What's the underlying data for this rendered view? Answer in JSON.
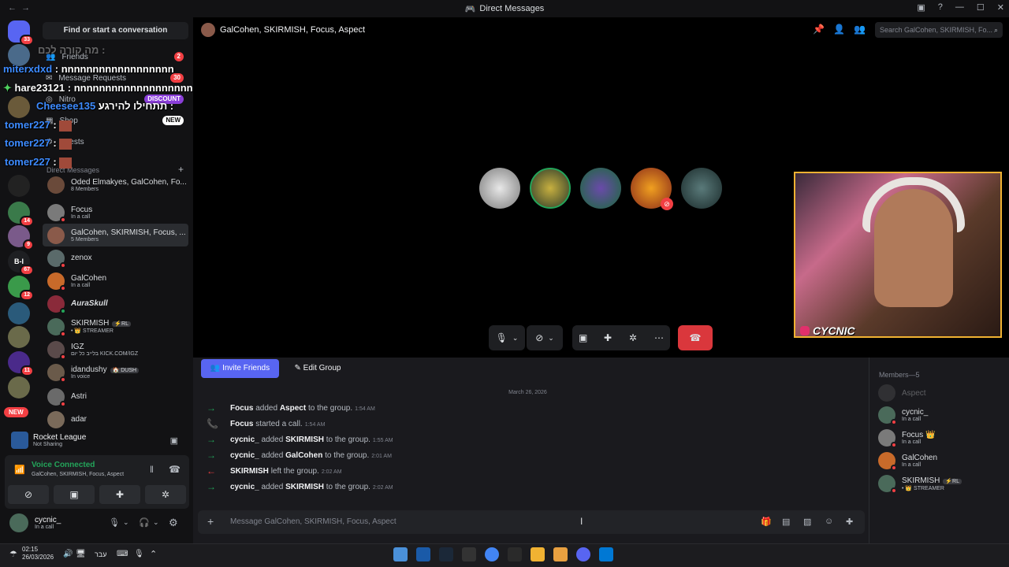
{
  "window": {
    "title": "Direct Messages"
  },
  "sidebar": {
    "find": "Find or start a conversation",
    "nav": [
      {
        "label": "Friends",
        "badge": "2"
      },
      {
        "label": "Message Requests",
        "badge": "30"
      },
      {
        "label": "Nitro",
        "badge": "DISCOUNT"
      },
      {
        "label": "Shop",
        "badge": "NEW"
      },
      {
        "label": "Quests",
        "badge": ""
      }
    ],
    "dm_header": "Direct Messages",
    "dm_add": "+",
    "dms": [
      {
        "name": "Oded Elmakyes, GalCohen, Fo...",
        "sub": "8 Members"
      },
      {
        "name": "Focus",
        "sub": "In a call"
      },
      {
        "name": "GalCohen, SKIRMISH, Focus, ...",
        "sub": "5 Members"
      },
      {
        "name": "zenox",
        "sub": ""
      },
      {
        "name": "GalCohen",
        "sub": "In a call"
      },
      {
        "name": "AuraSkull",
        "sub": ""
      },
      {
        "name": "SKIRMISH",
        "tag": "⚡RL",
        "sub": "• 👑 STREAMER"
      },
      {
        "name": "IGZ",
        "sub": "בלייב כל יום KICK.COM/IGZ"
      },
      {
        "name": "idandushy",
        "tag": "🏠 DUSH",
        "sub": "In voice"
      },
      {
        "name": "Astri",
        "sub": ""
      },
      {
        "name": "adar",
        "sub": ""
      }
    ],
    "game": {
      "title": "Rocket League",
      "sub": "Not Sharing"
    },
    "voice": {
      "status": "Voice Connected",
      "channel": "GalCohen, SKIRMISH, Focus, Aspect"
    },
    "user": {
      "name": "cycnic_",
      "status": "In a call"
    }
  },
  "rail": {
    "badges": [
      "33",
      "14",
      "9",
      "67",
      "12",
      "11"
    ],
    "new_label": "NEW",
    "bi_label": "B-I"
  },
  "overlay": [
    {
      "user": "",
      "text": "מה קורה לכם : ",
      "faint": true
    },
    {
      "user": "miterxdxd",
      "text": " : nnnnnnnnnnnnnnnnnn"
    },
    {
      "user": "hare23121",
      "text": " : nnnnnnnnnnnnnnnnnnn"
    },
    {
      "user": "Cheesee135",
      "text": "תתחילו להירגע : "
    },
    {
      "user": "tomer227",
      "text": " : "
    },
    {
      "user": "tomer227",
      "text": " : "
    },
    {
      "user": "tomer227",
      "text": " : "
    }
  ],
  "header": {
    "title": "GalCohen, SKIRMISH, Focus, Aspect",
    "search_placeholder": "Search GalCohen, SKIRMISH, Fo..."
  },
  "call": {
    "camera_name": "CYCNIC"
  },
  "chat": {
    "invite": "Invite Friends",
    "edit": "Edit Group",
    "date": "March 26, 2026",
    "messages": [
      {
        "who": "Focus",
        "action": "added",
        "target": "Aspect",
        "suffix": "to the group.",
        "time": "1:54 AM",
        "icon": "→",
        "color": "#23a55a"
      },
      {
        "who": "Focus",
        "action": "started a call.",
        "target": "",
        "suffix": "",
        "time": "1:54 AM",
        "icon": "📞",
        "color": "#23a55a"
      },
      {
        "who": "cycnic_",
        "action": "added",
        "target": "SKIRMISH",
        "suffix": "to the group.",
        "time": "1:55 AM",
        "icon": "→",
        "color": "#23a55a"
      },
      {
        "who": "cycnic_",
        "action": "added",
        "target": "GalCohen",
        "suffix": "to the group.",
        "time": "2:01 AM",
        "icon": "→",
        "color": "#23a55a"
      },
      {
        "who": "SKIRMISH",
        "action": "left the group.",
        "target": "",
        "suffix": "",
        "time": "2:02 AM",
        "icon": "←",
        "color": "#f23f43"
      },
      {
        "who": "cycnic_",
        "action": "added",
        "target": "SKIRMISH",
        "suffix": "to the group.",
        "time": "2:02 AM",
        "icon": "→",
        "color": "#23a55a"
      }
    ],
    "input_placeholder": "Message GalCohen, SKIRMISH, Focus, Aspect"
  },
  "members": {
    "header": "Members—5",
    "list": [
      {
        "name": "Aspect",
        "sub": "",
        "faded": true
      },
      {
        "name": "cycnic_",
        "sub": "In a call"
      },
      {
        "name": "Focus 👑",
        "sub": "In a call"
      },
      {
        "name": "GalCohen",
        "sub": "In a call"
      },
      {
        "name": "SKIRMISH",
        "tag": "⚡RL",
        "sub": "• 👑 STREAMER"
      }
    ]
  },
  "taskbar": {
    "time": "02:15",
    "date": "26/03/2026",
    "lang": "עבר"
  }
}
